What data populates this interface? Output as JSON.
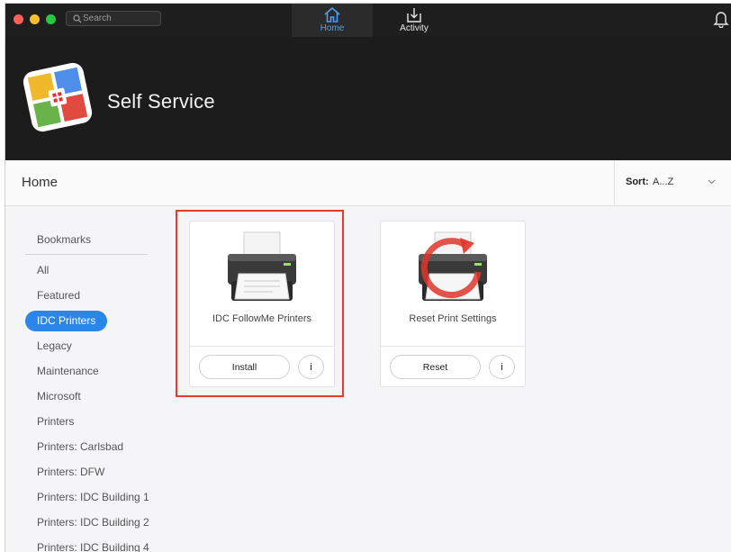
{
  "toolbar": {
    "search_placeholder": "Search",
    "nav": [
      {
        "label": "Home",
        "icon": "home-icon",
        "active": true
      },
      {
        "label": "Activity",
        "icon": "download-tray-icon",
        "active": false
      }
    ],
    "notification_icon": "bell-icon"
  },
  "banner": {
    "app_title": "Self Service",
    "logo_colors": [
      "#f0b82b",
      "#e04a3f",
      "#4f8ee8",
      "#68b34a"
    ]
  },
  "header": {
    "page_title": "Home",
    "sort_label": "Sort:",
    "sort_value": "A...Z"
  },
  "sidebar": {
    "heading": "Bookmarks",
    "items": [
      {
        "label": "All",
        "active": false
      },
      {
        "label": "Featured",
        "active": false
      },
      {
        "label": "IDC Printers",
        "active": true
      },
      {
        "label": "Legacy",
        "active": false
      },
      {
        "label": "Maintenance",
        "active": false
      },
      {
        "label": "Microsoft",
        "active": false
      },
      {
        "label": "Printers",
        "active": false
      },
      {
        "label": "Printers: Carlsbad",
        "active": false
      },
      {
        "label": "Printers: DFW",
        "active": false
      },
      {
        "label": "Printers: IDC Building 1",
        "active": false
      },
      {
        "label": "Printers: IDC Building 2",
        "active": false
      },
      {
        "label": "Printers: IDC Building 4",
        "active": false
      }
    ]
  },
  "cards": [
    {
      "title": "IDC FollowMe Printers",
      "action": "Install",
      "info": "i",
      "highlighted": true
    },
    {
      "title": "Reset Print Settings",
      "action": "Reset",
      "info": "i",
      "highlighted": false
    }
  ],
  "colors": {
    "accent": "#2a86e8",
    "highlight": "#e63a2e",
    "toolbar_bg": "#1e1e1e"
  }
}
